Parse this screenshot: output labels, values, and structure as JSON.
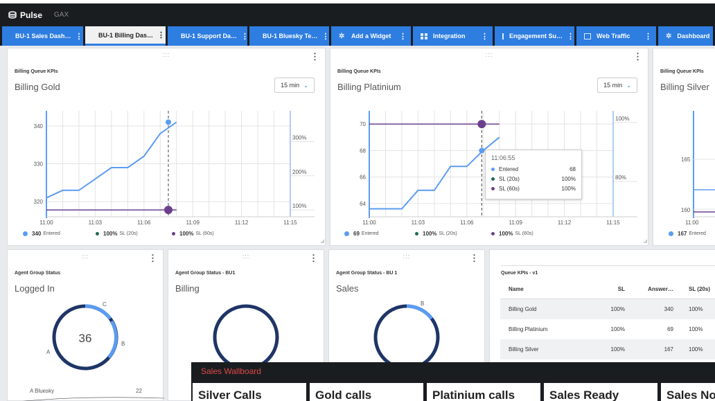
{
  "app": {
    "name": "Pulse",
    "org": "GAX"
  },
  "tabs": [
    {
      "label": "BU-1 Sales Dash…",
      "icon": "grid"
    },
    {
      "label": "BU-1 Billing Das…",
      "icon": "grid",
      "active": true
    },
    {
      "label": "BU-1 Support Da…",
      "icon": "grid"
    },
    {
      "label": "BU-1 Bluesky Te…",
      "icon": "grid"
    },
    {
      "label": "Add a Widget",
      "icon": "gear"
    },
    {
      "label": "Integration",
      "icon": "grid"
    },
    {
      "label": "Engagement Su…",
      "icon": "external"
    },
    {
      "label": "Web Traffic",
      "icon": "external"
    },
    {
      "label": "Dashboard",
      "icon": "gear"
    }
  ],
  "kpi_cards": [
    {
      "section": "Billing Queue KPIs",
      "title": "Billing Gold",
      "interval": "15 min",
      "legend": [
        {
          "value": "340",
          "label": "Entered",
          "color": "#5b9cf2"
        },
        {
          "value": "100%",
          "label": "SL (20s)",
          "color": "#1d6b4f"
        },
        {
          "value": "100%",
          "label": "SL (60s)",
          "color": "#6b3f8e"
        }
      ]
    },
    {
      "section": "Billing Queue KPIs",
      "title": "Billing Platinium",
      "interval": "15 min",
      "legend": [
        {
          "value": "69",
          "label": "Entered",
          "color": "#5b9cf2"
        },
        {
          "value": "100%",
          "label": "SL (20s)",
          "color": "#1d6b4f"
        },
        {
          "value": "100%",
          "label": "SL (60s)",
          "color": "#6b3f8e"
        }
      ]
    },
    {
      "section": "Billing Queue KPIs",
      "title": "Billing Silver",
      "legend": [
        {
          "value": "167",
          "label": "Entered",
          "color": "#5b9cf2"
        }
      ]
    }
  ],
  "chart_data": [
    {
      "type": "line",
      "title": "Billing Gold",
      "x": [
        "11:00",
        "11:01",
        "11:02",
        "11:03",
        "11:04",
        "11:05",
        "11:06",
        "11:07",
        "11:08"
      ],
      "x_ticks": [
        "11:00",
        "11:03",
        "11:06",
        "11:09",
        "11:12",
        "11:15"
      ],
      "y_ticks": [
        "320",
        "330",
        "340"
      ],
      "y2_ticks": [
        "100%",
        "200%",
        "300%"
      ],
      "ylim": [
        316,
        344
      ],
      "y2lim": [
        80,
        390
      ],
      "series": [
        {
          "name": "Entered",
          "color": "#5b9cf2",
          "values": [
            321,
            323,
            323,
            326,
            329,
            329,
            332,
            338,
            341
          ]
        },
        {
          "name": "SL (60s)",
          "color": "#6b3f8e",
          "axis": "y2",
          "values": [
            100,
            100,
            100,
            100,
            100,
            100,
            100,
            100,
            100
          ]
        }
      ],
      "cursor_x": "11:07:30"
    },
    {
      "type": "line",
      "title": "Billing Platinium",
      "x": [
        "11:00",
        "11:01",
        "11:02",
        "11:03",
        "11:04",
        "11:05",
        "11:06",
        "11:07",
        "11:08"
      ],
      "x_ticks": [
        "11:00",
        "11:03",
        "11:06",
        "11:09",
        "11:12",
        "11:15"
      ],
      "y_ticks": [
        "64",
        "66",
        "68",
        "70"
      ],
      "y2_ticks": [
        "80%",
        "100%"
      ],
      "ylim": [
        63,
        71
      ],
      "y2lim": [
        68,
        104
      ],
      "series": [
        {
          "name": "Entered",
          "color": "#5b9cf2",
          "values": [
            63.6,
            63.6,
            63.6,
            65,
            65,
            66.8,
            66.8,
            68,
            69
          ]
        },
        {
          "name": "SL (60s)",
          "color": "#6b3f8e",
          "values": [
            70,
            70,
            70,
            70,
            70,
            70,
            70,
            70,
            70
          ]
        }
      ],
      "cursor_x": "11:06:55"
    },
    {
      "type": "line",
      "title": "Billing Silver",
      "y_ticks": [
        "160",
        "165"
      ],
      "x_ticks": [
        "11:00"
      ]
    }
  ],
  "tooltip": {
    "time": "11:06:55",
    "rows": [
      {
        "label": "Entered",
        "value": "68",
        "color": "#5b9cf2"
      },
      {
        "label": "SL (20s)",
        "value": "100%",
        "color": "#1d6b4f"
      },
      {
        "label": "SL (60s)",
        "value": "100%",
        "color": "#6b3f8e"
      }
    ]
  },
  "agent_cards": [
    {
      "section": "Agent Group Status",
      "title": "Logged In",
      "center": "36",
      "segments": [
        "A",
        "B",
        "C"
      ],
      "legend_row": {
        "label": "A  Bluesky",
        "value": "22"
      }
    },
    {
      "section": "Agent Group Status - BU1",
      "title": "Billing"
    },
    {
      "section": "Agent Group Status - BU 1",
      "title": "Sales",
      "segments": [
        "B"
      ]
    }
  ],
  "queue_table": {
    "section": "Queue KPIs - v1",
    "columns": [
      "Name",
      "SL",
      "Answer…",
      "SL (20s)"
    ],
    "rows": [
      [
        "Billing Gold",
        "100%",
        "340",
        "100%"
      ],
      [
        "Billing Platinium",
        "100%",
        "69",
        "100%"
      ],
      [
        "Billing Silver",
        "100%",
        "167",
        "100%"
      ]
    ]
  },
  "wallboard": {
    "title": "Sales Wallboard",
    "cards": [
      "Silver Calls",
      "Gold calls",
      "Platinium calls",
      "Sales Ready",
      "Sales Not Ready"
    ]
  }
}
